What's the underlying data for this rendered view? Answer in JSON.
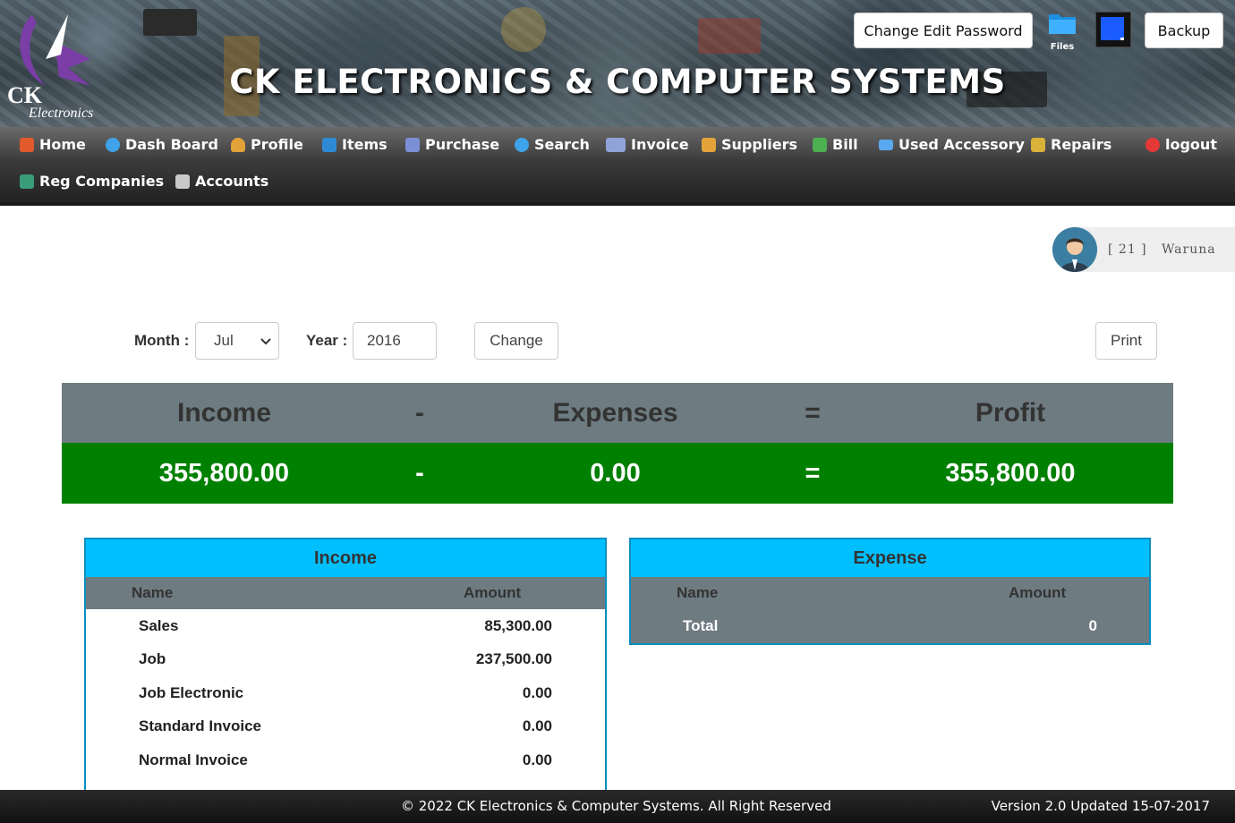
{
  "header": {
    "logo_ck": "CK",
    "logo_electronics": "Electronics",
    "title": "CK ELECTRONICS & COMPUTER SYSTEMS",
    "change_password_label": "Change Edit Password",
    "files_label": "Files",
    "backup_label": "Backup"
  },
  "nav": {
    "row1": [
      {
        "label": "Home",
        "icon": "home-icon"
      },
      {
        "label": "Dash Board",
        "icon": "dashboard-icon"
      },
      {
        "label": "Profile",
        "icon": "profile-icon"
      },
      {
        "label": "Items",
        "icon": "items-icon"
      },
      {
        "label": "Purchase",
        "icon": "purchase-icon"
      },
      {
        "label": "Search",
        "icon": "search-icon"
      },
      {
        "label": "Invoice",
        "icon": "invoice-icon"
      },
      {
        "label": "Suppliers",
        "icon": "suppliers-icon"
      },
      {
        "label": "Bill",
        "icon": "bill-icon"
      },
      {
        "label": "Used Accessory",
        "icon": "accessory-icon"
      },
      {
        "label": "Repairs",
        "icon": "repairs-icon"
      },
      {
        "label": "logout",
        "icon": "power-icon"
      }
    ],
    "row2": [
      {
        "label": "Reg Companies",
        "icon": "companies-icon"
      },
      {
        "label": "Accounts",
        "icon": "accounts-icon"
      }
    ]
  },
  "user": {
    "id_text": "[ 21 ]",
    "name": "Waruna"
  },
  "filter": {
    "month_label": "Month :",
    "month_value": "Jul",
    "year_label": "Year :",
    "year_value": "2016",
    "change_label": "Change",
    "print_label": "Print"
  },
  "summary": {
    "headers": [
      "Income",
      "-",
      "Expenses",
      "=",
      "Profit"
    ],
    "values": [
      "355,800.00",
      "-",
      "0.00",
      "=",
      "355,800.00"
    ]
  },
  "income_panel": {
    "title": "Income",
    "col_name": "Name",
    "col_amount": "Amount",
    "rows": [
      {
        "name": "Sales",
        "amount": "85,300.00"
      },
      {
        "name": "Job",
        "amount": "237,500.00"
      },
      {
        "name": "Job Electronic",
        "amount": "0.00"
      },
      {
        "name": "Standard Invoice",
        "amount": "0.00"
      },
      {
        "name": "Normal Invoice",
        "amount": "0.00"
      }
    ]
  },
  "expense_panel": {
    "title": "Expense",
    "col_name": "Name",
    "col_amount": "Amount",
    "total_label": "Total",
    "total_value": "0"
  },
  "footer": {
    "copyright": "© 2022  CK Electronics & Computer Systems. All Right Reserved",
    "version": "Version 2.0 Updated 15-07-2017"
  },
  "colors": {
    "summary_head": "#6e7b80",
    "summary_values": "#008000",
    "panel_title": "#00bfff",
    "panel_border": "#0a8fc0"
  }
}
